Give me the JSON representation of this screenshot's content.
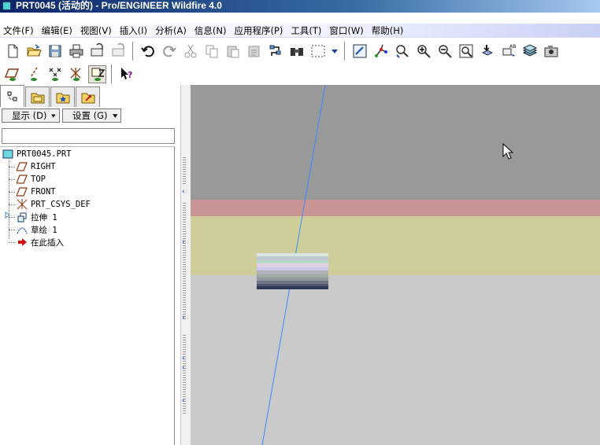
{
  "window": {
    "title": "PRT0045 (活动的) - Pro/ENGINEER Wildfire 4.0"
  },
  "menu": [
    "文件(F)",
    "编辑(E)",
    "视图(V)",
    "插入(I)",
    "分析(A)",
    "信息(N)",
    "应用程序(P)",
    "工具(T)",
    "窗口(W)",
    "帮助(H)"
  ],
  "panel": {
    "show_label": "显示 (D)",
    "settings_label": "设置 (G)",
    "search_value": ""
  },
  "tree": {
    "root": "PRT0045.PRT",
    "items": [
      {
        "label": "RIGHT",
        "icon": "datum-plane-icon"
      },
      {
        "label": "TOP",
        "icon": "datum-plane-icon"
      },
      {
        "label": "FRONT",
        "icon": "datum-plane-icon"
      },
      {
        "label": "PRT_CSYS_DEF",
        "icon": "csys-icon"
      },
      {
        "label": "拉伸 1",
        "icon": "extrude-icon"
      },
      {
        "label": "草绘 1",
        "icon": "sketch-icon"
      },
      {
        "label": "在此插入",
        "icon": "insert-here-arrow-icon"
      }
    ]
  },
  "colors": {
    "viewport_top": "#999999",
    "band_red": "#c89494",
    "band_yellow": "#cfcd99",
    "viewport_bottom": "#cacaca",
    "datum_axis_line": "#3a8cff",
    "title_active": "#0a246a"
  }
}
